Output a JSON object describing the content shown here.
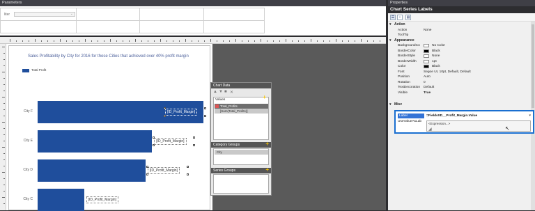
{
  "parameters": {
    "title": "Parameters",
    "label": "liter"
  },
  "report": {
    "title": "Sales Profitability by City for 2016 for those Cities that achieved over 40% profit margin",
    "legend": "Total Profit"
  },
  "chart_data": {
    "type": "bar",
    "categories": [
      "City F",
      "City E",
      "City D",
      "City C"
    ],
    "series": [
      {
        "name": "Total Profit",
        "values": [
          100,
          69,
          65,
          28
        ]
      }
    ],
    "title": "Sales Profitability by City for 2016 for those Cities that achieved over 40% profit margin",
    "data_labels": [
      "[ID_Profit_Margin]",
      "[ID_Profit_Margin]",
      "[ID_Profit_Margin]",
      "[ID_Profit_Margin]"
    ],
    "orientation": "horizontal",
    "legend_position": "top-left",
    "colors": [
      "#1f4e9c"
    ]
  },
  "chart_data_panel": {
    "title": "Chart Data",
    "values_header": "Values",
    "value_item": "Total_Profits",
    "value_expr": "[Sum(Total_Profits)]",
    "category_header": "Category Groups",
    "category_item": "City",
    "series_header": "Series Groups"
  },
  "properties": {
    "pane_title": "Properties",
    "object_title": "Chart Series Labels",
    "groups": {
      "action": "Action",
      "appearance": "Appearance",
      "misc": "Misc"
    },
    "action_rows": [
      {
        "key": "Action",
        "value": "None"
      },
      {
        "key": "ToolTip",
        "value": ""
      }
    ],
    "appearance_rows": [
      {
        "key": "BackgroundCo",
        "value": "No Color",
        "swatch": "#ffffff"
      },
      {
        "key": "BorderColor",
        "value": "Black",
        "swatch": "#000000"
      },
      {
        "key": "BorderStyle",
        "value": "None",
        "swatch": "#ffffff"
      },
      {
        "key": "BorderWidth",
        "value": "1pt",
        "swatch": "#ffffff"
      },
      {
        "key": "Color",
        "value": "Black",
        "swatch": "#000000"
      },
      {
        "key": "Font",
        "value": "Segoe UI, 10pt, Default, Default"
      },
      {
        "key": "Position",
        "value": "Auto"
      },
      {
        "key": "Rotation",
        "value": "0"
      },
      {
        "key": "TextDecoration",
        "value": "Default"
      },
      {
        "key": "Visible",
        "value": "True"
      }
    ],
    "misc": {
      "label_key": "Label",
      "label_value": "=Fields!ID__Profit_Margin.Value",
      "use_value_key": "UseValueAsLab",
      "expression_option": "<Expression...>"
    },
    "colors": {
      "highlight": "#1a6fd0",
      "selected": "#3373d6"
    }
  }
}
